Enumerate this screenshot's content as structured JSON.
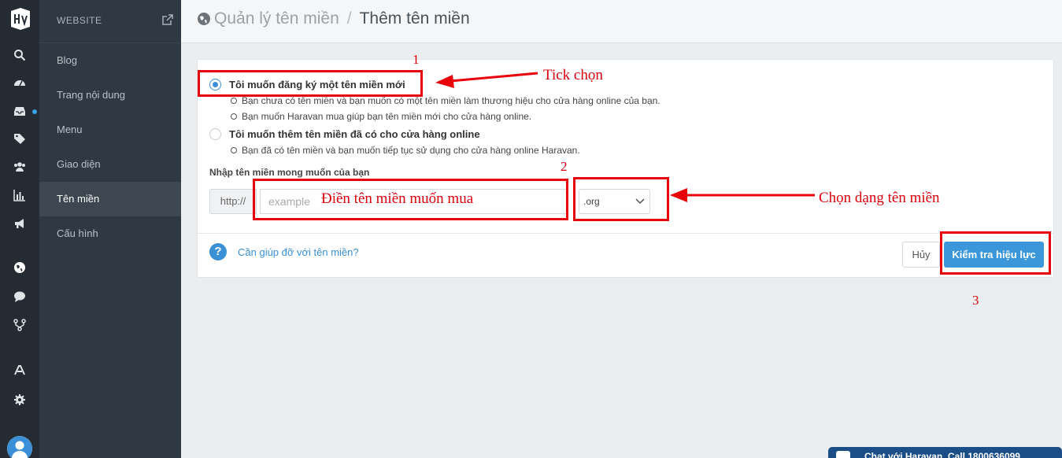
{
  "rail": {
    "icons": [
      "store-logo-icon",
      "search-icon",
      "dashboard-icon",
      "inbox-icon",
      "tag-icon",
      "users-icon",
      "bar-chart-icon",
      "bullhorn-icon",
      "globe-icon",
      "chat-icon",
      "share-icon",
      "apps-icon",
      "gear-icon",
      "user-avatar-icon"
    ],
    "notification_color": "#3aa3e3"
  },
  "subnav": {
    "header": "WEBSITE",
    "items": [
      {
        "label": "Blog"
      },
      {
        "label": "Trang nội dung"
      },
      {
        "label": "Menu"
      },
      {
        "label": "Giao diện"
      },
      {
        "label": "Tên miền"
      },
      {
        "label": "Cấu hình"
      }
    ]
  },
  "breadcrumb": {
    "parent": "Quản lý tên miền",
    "separator": "/",
    "current": "Thêm tên miền"
  },
  "form": {
    "option_new": {
      "label": "Tôi muốn đăng ký một tên miền mới",
      "desc1": "Bạn chưa có tên miền và bạn muốn có một tên miền làm thương hiệu cho cửa hàng online của bạn.",
      "desc2": "Bạn muốn Haravan mua giúp bạn tên miền mới cho cửa hàng online."
    },
    "option_existing": {
      "label": "Tôi muốn thêm tên miền đã có cho cửa hàng online",
      "desc1": "Bạn đã có tên miền và bạn muốn tiếp tục sử dụng cho cửa hàng online Haravan."
    },
    "domain_label": "Nhập tên miền mong muốn của bạn",
    "prefix": "http://",
    "domain_placeholder": "example",
    "tld_selected": ".org",
    "help_icon_text": "?",
    "help_link": "Cần giúp đỡ với tên miền?",
    "cancel_label": "Hủy",
    "check_label": "Kiểm tra hiệu lực",
    "accent_color": "#3b97d9"
  },
  "annotations": {
    "n1": "1",
    "n2": "2",
    "n3": "3",
    "tick_text": "Tick chọn",
    "fill_text": "Điền tên miền muốn mua",
    "choose_text": "Chọn dạng tên miền",
    "color": "#e8000b"
  },
  "chat": {
    "label": "Chat với Haravan, Call 1800636099"
  }
}
